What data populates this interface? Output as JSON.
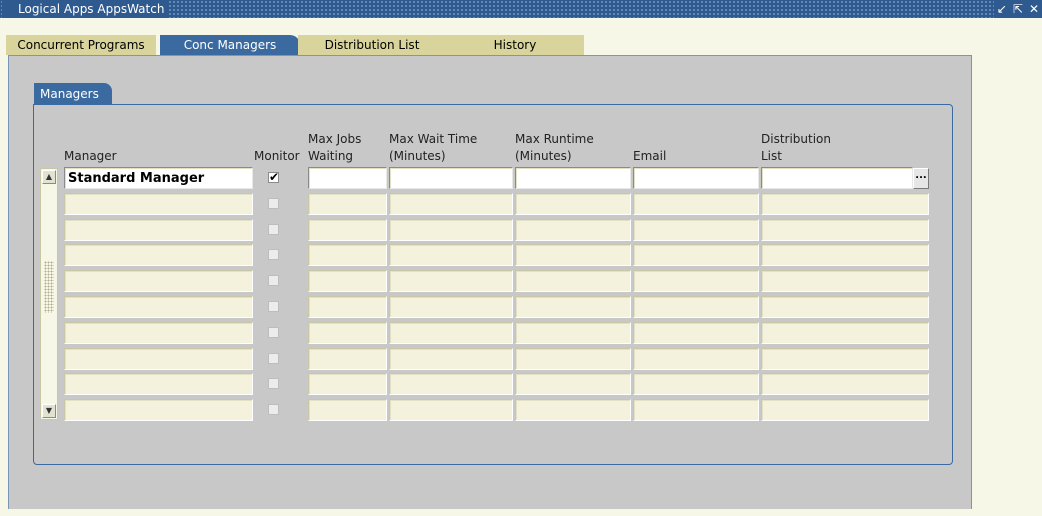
{
  "window": {
    "title": "Logical Apps AppsWatch",
    "controls": [
      "↙",
      "⇱",
      "✕"
    ]
  },
  "tabs": [
    {
      "label": "Concurrent Programs",
      "active": false
    },
    {
      "label": "Conc Managers",
      "active": true
    },
    {
      "label": "Distribution List",
      "active": false
    },
    {
      "label": "History",
      "active": false
    }
  ],
  "subtab": {
    "label": "Managers"
  },
  "columns": {
    "manager": "Manager",
    "monitor": "Monitor",
    "max_jobs_1": "Max Jobs",
    "max_jobs_2": "Waiting",
    "max_wait_1": "Max Wait Time",
    "max_wait_2": "(Minutes)",
    "max_runtime_1": "Max Runtime",
    "max_runtime_2": "(Minutes)",
    "email": "Email",
    "distribution_1": "Distribution",
    "distribution_2": "List"
  },
  "rows": [
    {
      "manager": "Standard Manager",
      "monitor": true,
      "max_jobs": "",
      "max_wait": "",
      "max_runtime": "",
      "email": "",
      "distribution": ""
    },
    {
      "manager": "",
      "monitor": false
    },
    {
      "manager": "",
      "monitor": false
    },
    {
      "manager": "",
      "monitor": false
    },
    {
      "manager": "",
      "monitor": false
    },
    {
      "manager": "",
      "monitor": false
    },
    {
      "manager": "",
      "monitor": false
    },
    {
      "manager": "",
      "monitor": false
    },
    {
      "manager": "",
      "monitor": false
    },
    {
      "manager": "",
      "monitor": false
    }
  ],
  "lov_button": "...",
  "colors": {
    "titlebar": "#2f5a8f",
    "active_tab": "#3b6aa0",
    "inactive_tab": "#d9d49b",
    "canvas": "#c8c8c8",
    "field": "#f4f2dc"
  }
}
